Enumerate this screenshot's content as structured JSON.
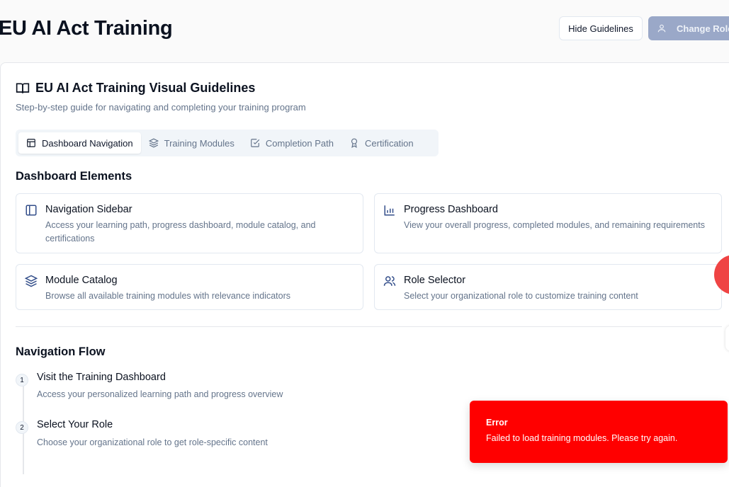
{
  "header": {
    "title": "EU AI Act Training",
    "hide_guidelines_label": "Hide Guidelines",
    "change_role_label": "Change Role"
  },
  "guidelines": {
    "title": "EU AI Act Training Visual Guidelines",
    "subtitle": "Step-by-step guide for navigating and completing your training program",
    "tabs": [
      {
        "label": "Dashboard Navigation",
        "icon": "layout-icon",
        "active": true
      },
      {
        "label": "Training Modules",
        "icon": "layers-icon",
        "active": false
      },
      {
        "label": "Completion Path",
        "icon": "check-square-icon",
        "active": false
      },
      {
        "label": "Certification",
        "icon": "award-icon",
        "active": false
      }
    ]
  },
  "dashboard_elements": {
    "heading": "Dashboard Elements",
    "items": [
      {
        "title": "Navigation Sidebar",
        "desc": "Access your learning path, progress dashboard, module catalog, and certifications",
        "icon": "sidebar-icon"
      },
      {
        "title": "Progress Dashboard",
        "desc": "View your overall progress, completed modules, and remaining requirements",
        "icon": "bar-chart-icon"
      },
      {
        "title": "Module Catalog",
        "desc": "Browse all available training modules with relevance indicators",
        "icon": "layers-icon"
      },
      {
        "title": "Role Selector",
        "desc": "Select your organizational role to customize training content",
        "icon": "users-icon"
      }
    ]
  },
  "navigation_flow": {
    "heading": "Navigation Flow",
    "steps": [
      {
        "num": "1",
        "title": "Visit the Training Dashboard",
        "desc": "Access your personalized learning path and progress overview"
      },
      {
        "num": "2",
        "title": "Select Your Role",
        "desc": "Choose your organizational role to get role-specific content"
      }
    ]
  },
  "toast": {
    "title": "Error",
    "message": "Failed to load training modules. Please try again."
  },
  "colors": {
    "accent": "#9aa8c8",
    "error": "#ff0000",
    "muted_text": "#64748b"
  }
}
